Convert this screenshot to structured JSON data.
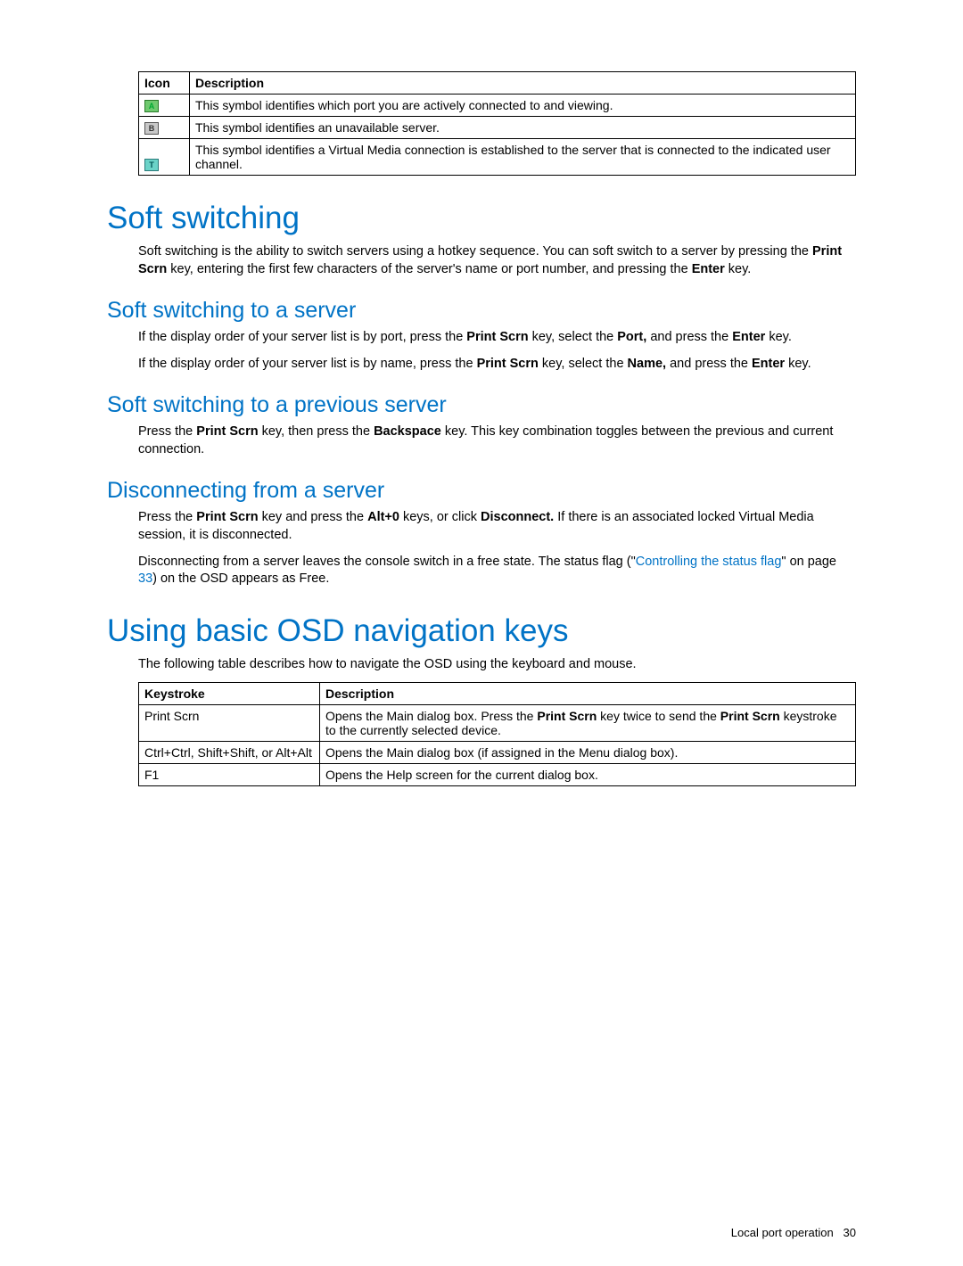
{
  "iconTable": {
    "headers": {
      "icon": "Icon",
      "desc": "Description"
    },
    "rows": [
      {
        "letter": "A",
        "desc": "This symbol identifies which port you are actively connected to and viewing."
      },
      {
        "letter": "B",
        "desc": "This symbol identifies an unavailable server."
      },
      {
        "letter": "T",
        "desc": "This symbol identifies a Virtual Media connection is established to the server that is connected to the indicated user channel."
      }
    ]
  },
  "h1_soft": "Soft switching",
  "soft_para_a": "Soft switching is the ability to switch servers using a hotkey sequence. You can soft switch to a server by pressing the ",
  "soft_para_b": "Print Scrn",
  "soft_para_c": " key, entering the first few characters of the server's name or port number, and pressing the ",
  "soft_para_d": "Enter",
  "soft_para_e": " key.",
  "h2_to_server": "Soft switching to a server",
  "toserver_p1a": "If the display order of your server list is by port, press the ",
  "toserver_p1b": "Print Scrn",
  "toserver_p1c": " key, select the ",
  "toserver_p1d": "Port,",
  "toserver_p1e": " and press the ",
  "toserver_p1f": "Enter",
  "toserver_p1g": " key.",
  "toserver_p2a": "If the display order of your server list is by name, press the ",
  "toserver_p2b": "Print Scrn",
  "toserver_p2c": " key, select the ",
  "toserver_p2d": "Name,",
  "toserver_p2e": " and press the ",
  "toserver_p2f": "Enter",
  "toserver_p2g": " key.",
  "h2_prev": "Soft switching to a previous server",
  "prev_a": "Press the ",
  "prev_b": "Print Scrn",
  "prev_c": " key, then press the ",
  "prev_d": "Backspace",
  "prev_e": " key. This key combination toggles between the previous and current connection.",
  "h2_disc": "Disconnecting from a server",
  "disc_p1a": "Press the ",
  "disc_p1b": "Print Scrn",
  "disc_p1c": " key and press the ",
  "disc_p1d": "Alt+0",
  "disc_p1e": " keys, or click ",
  "disc_p1f": "Disconnect.",
  "disc_p1g": " If there is an associated locked Virtual Media session, it is disconnected.",
  "disc_p2a": "Disconnecting from a server leaves the console switch in a free state. The status flag (\"",
  "disc_p2b": "Controlling the status flag",
  "disc_p2c": "\" on page ",
  "disc_p2d": "33",
  "disc_p2e": ") on the OSD appears as Free.",
  "h1_osd": "Using basic OSD navigation keys",
  "osd_intro": "The following table describes how to navigate the OSD using the keyboard and mouse.",
  "keysTable": {
    "headers": {
      "k": "Keystroke",
      "d": "Description"
    },
    "rows": [
      {
        "k": "Print Scrn",
        "d_a": "Opens the Main dialog box. Press the ",
        "d_b": "Print Scrn",
        "d_c": " key twice to send the ",
        "d_d": "Print Scrn",
        "d_e": " keystroke to the currently selected device."
      },
      {
        "k": "Ctrl+Ctrl, Shift+Shift, or Alt+Alt",
        "d_a": "Opens the Main dialog box (if assigned in the Menu dialog box).",
        "d_b": "",
        "d_c": "",
        "d_d": "",
        "d_e": ""
      },
      {
        "k": "F1",
        "d_a": "Opens the Help screen for the current dialog box.",
        "d_b": "",
        "d_c": "",
        "d_d": "",
        "d_e": ""
      }
    ]
  },
  "footer_text": "Local port operation",
  "footer_page": "30"
}
